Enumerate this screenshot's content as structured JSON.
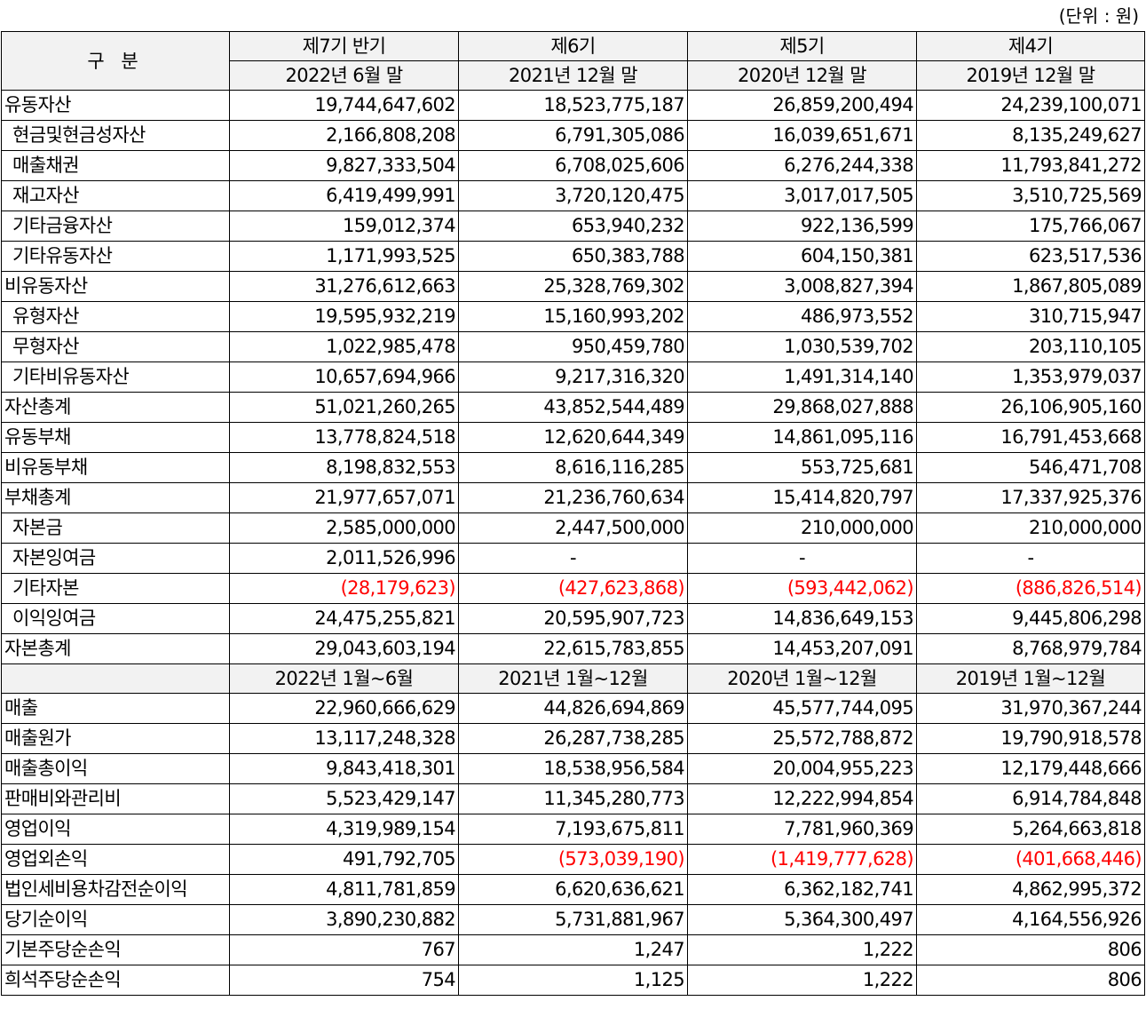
{
  "unit_note": "(단위 : 원)",
  "header": {
    "gubun": "구 분",
    "periods": [
      "제7기 반기",
      "제6기",
      "제5기",
      "제4기"
    ],
    "dates": [
      "2022년 6월 말",
      "2021년 12월 말",
      "2020년 12월 말",
      "2019년 12월 말"
    ],
    "income_periods": [
      "2022년 1월~6월",
      "2021년 1월~12월",
      "2020년 1월~12월",
      "2019년 1월~12월"
    ]
  },
  "balance_rows": [
    {
      "label": "유동자산",
      "indent": false,
      "values": [
        "19,744,647,602",
        "18,523,775,187",
        "26,859,200,494",
        "24,239,100,071"
      ]
    },
    {
      "label": "현금및현금성자산",
      "indent": true,
      "values": [
        "2,166,808,208",
        "6,791,305,086",
        "16,039,651,671",
        "8,135,249,627"
      ]
    },
    {
      "label": "매출채권",
      "indent": true,
      "values": [
        "9,827,333,504",
        "6,708,025,606",
        "6,276,244,338",
        "11,793,841,272"
      ]
    },
    {
      "label": "재고자산",
      "indent": true,
      "values": [
        "6,419,499,991",
        "3,720,120,475",
        "3,017,017,505",
        "3,510,725,569"
      ]
    },
    {
      "label": "기타금융자산",
      "indent": true,
      "values": [
        "159,012,374",
        "653,940,232",
        "922,136,599",
        "175,766,067"
      ]
    },
    {
      "label": "기타유동자산",
      "indent": true,
      "values": [
        "1,171,993,525",
        "650,383,788",
        "604,150,381",
        "623,517,536"
      ]
    },
    {
      "label": "비유동자산",
      "indent": false,
      "values": [
        "31,276,612,663",
        "25,328,769,302",
        "3,008,827,394",
        "1,867,805,089"
      ]
    },
    {
      "label": "유형자산",
      "indent": true,
      "values": [
        "19,595,932,219",
        "15,160,993,202",
        "486,973,552",
        "310,715,947"
      ]
    },
    {
      "label": "무형자산",
      "indent": true,
      "values": [
        "1,022,985,478",
        "950,459,780",
        "1,030,539,702",
        "203,110,105"
      ]
    },
    {
      "label": "기타비유동자산",
      "indent": true,
      "values": [
        "10,657,694,966",
        "9,217,316,320",
        "1,491,314,140",
        "1,353,979,037"
      ]
    },
    {
      "label": "자산총계",
      "indent": false,
      "values": [
        "51,021,260,265",
        "43,852,544,489",
        "29,868,027,888",
        "26,106,905,160"
      ]
    },
    {
      "label": "유동부채",
      "indent": false,
      "values": [
        "13,778,824,518",
        "12,620,644,349",
        "14,861,095,116",
        "16,791,453,668"
      ]
    },
    {
      "label": "비유동부채",
      "indent": false,
      "values": [
        "8,198,832,553",
        "8,616,116,285",
        "553,725,681",
        "546,471,708"
      ]
    },
    {
      "label": "부채총계",
      "indent": false,
      "values": [
        "21,977,657,071",
        "21,236,760,634",
        "15,414,820,797",
        "17,337,925,376"
      ]
    },
    {
      "label": "자본금",
      "indent": true,
      "values": [
        "2,585,000,000",
        "2,447,500,000",
        "210,000,000",
        "210,000,000"
      ]
    },
    {
      "label": "자본잉여금",
      "indent": true,
      "values": [
        "2,011,526,996",
        "-",
        "-",
        "-"
      ]
    },
    {
      "label": "기타자본",
      "indent": true,
      "values": [
        "(28,179,623)",
        "(427,623,868)",
        "(593,442,062)",
        "(886,826,514)"
      ]
    },
    {
      "label": "이익잉여금",
      "indent": true,
      "values": [
        "24,475,255,821",
        "20,595,907,723",
        "14,836,649,153",
        "9,445,806,298"
      ]
    },
    {
      "label": "자본총계",
      "indent": false,
      "values": [
        "29,043,603,194",
        "22,615,783,855",
        "14,453,207,091",
        "8,768,979,784"
      ]
    }
  ],
  "income_rows": [
    {
      "label": "매출",
      "indent": false,
      "values": [
        "22,960,666,629",
        "44,826,694,869",
        "45,577,744,095",
        "31,970,367,244"
      ]
    },
    {
      "label": "매출원가",
      "indent": false,
      "values": [
        "13,117,248,328",
        "26,287,738,285",
        "25,572,788,872",
        "19,790,918,578"
      ]
    },
    {
      "label": "매출총이익",
      "indent": false,
      "values": [
        "9,843,418,301",
        "18,538,956,584",
        "20,004,955,223",
        "12,179,448,666"
      ]
    },
    {
      "label": "판매비와관리비",
      "indent": false,
      "values": [
        "5,523,429,147",
        "11,345,280,773",
        "12,222,994,854",
        "6,914,784,848"
      ]
    },
    {
      "label": "영업이익",
      "indent": false,
      "values": [
        "4,319,989,154",
        "7,193,675,811",
        "7,781,960,369",
        "5,264,663,818"
      ]
    },
    {
      "label": "영업외손익",
      "indent": false,
      "values": [
        "491,792,705",
        "(573,039,190)",
        "(1,419,777,628)",
        "(401,668,446)"
      ]
    },
    {
      "label": "법인세비용차감전순이익",
      "indent": false,
      "values": [
        "4,811,781,859",
        "6,620,636,621",
        "6,362,182,741",
        "4,862,995,372"
      ]
    },
    {
      "label": "당기순이익",
      "indent": false,
      "values": [
        "3,890,230,882",
        "5,731,881,967",
        "5,364,300,497",
        "4,164,556,926"
      ]
    },
    {
      "label": "기본주당순손익",
      "indent": false,
      "values": [
        "767",
        "1,247",
        "1,222",
        "806"
      ]
    },
    {
      "label": "희석주당순손익",
      "indent": false,
      "values": [
        "754",
        "1,125",
        "1,222",
        "806"
      ]
    }
  ],
  "colors": {
    "negative": "#ff0000",
    "header_bg": "#f2f2f2",
    "border": "#000000"
  }
}
